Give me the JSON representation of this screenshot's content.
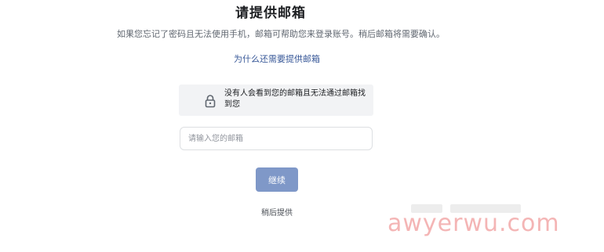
{
  "page": {
    "title": "请提供邮箱",
    "description": "如果您忘记了密码且无法使用手机，邮箱可帮助您来登录账号。稍后邮箱将需要确认。",
    "why_link": "为什么还需要提供邮箱"
  },
  "notice": {
    "icon": "lock-icon",
    "text": "没有人会看到您的邮箱且无法通过邮箱找到您"
  },
  "email_input": {
    "value": "",
    "placeholder": "请输入您的邮箱"
  },
  "buttons": {
    "continue_label": "继续",
    "later_label": "稍后提供"
  },
  "watermark": {
    "text": "awyerwu.com"
  },
  "colors": {
    "primary_button": "#7f98c8",
    "link": "#385898",
    "notice_bg": "#f2f3f5",
    "watermark": "#f4b5b5"
  }
}
